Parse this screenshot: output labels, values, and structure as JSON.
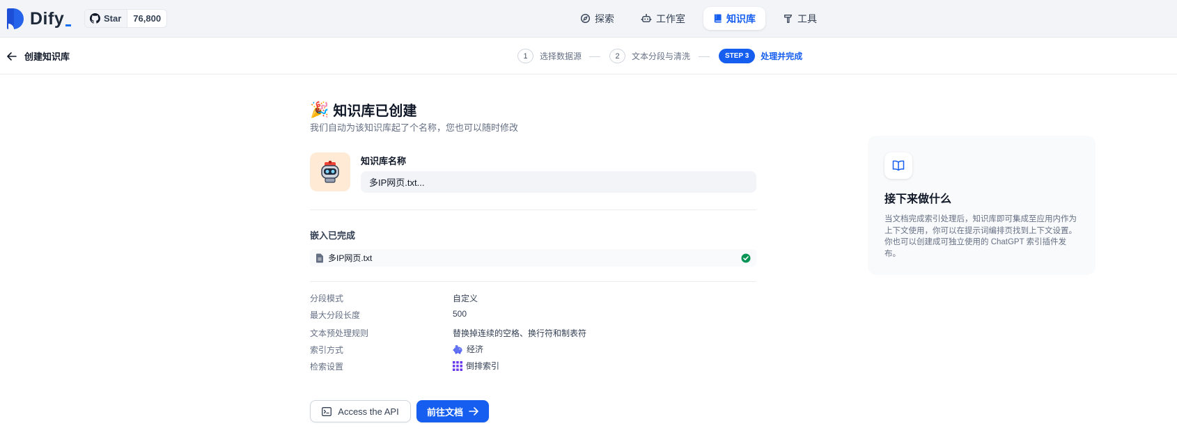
{
  "app": {
    "logo_text": "Dify"
  },
  "github": {
    "star_label": "Star",
    "star_count": "76,800"
  },
  "nav": [
    {
      "label": "探索",
      "icon": "compass-icon"
    },
    {
      "label": "工作室",
      "icon": "robot-icon"
    },
    {
      "label": "知识库",
      "icon": "book-icon",
      "active": true
    },
    {
      "label": "工具",
      "icon": "hammer-icon"
    }
  ],
  "subheader": {
    "back_label": "创建知识库",
    "steps": [
      {
        "num": "1",
        "label": "选择数据源"
      },
      {
        "num": "2",
        "label": "文本分段与清洗"
      },
      {
        "num": "STEP 3",
        "label": "处理并完成",
        "active": true
      }
    ]
  },
  "main": {
    "title": "知识库已创建",
    "description": "我们自动为该知识库起了个名称，您也可以随时修改",
    "kb_name_label": "知识库名称",
    "kb_name_value": "多IP网页.txt...",
    "embed_title": "嵌入已完成",
    "file_name": "多IP网页.txt",
    "info": [
      {
        "label": "分段模式",
        "value": "自定义"
      },
      {
        "label": "最大分段长度",
        "value": "500"
      },
      {
        "label": "文本预处理规则",
        "value": "替换掉连续的空格、换行符和制表符"
      },
      {
        "label": "索引方式",
        "value": "经济",
        "icon": "piggy-bank-icon"
      },
      {
        "label": "检索设置",
        "value": "倒排索引",
        "icon": "grid-dots-icon"
      }
    ],
    "api_button": "Access the API",
    "docs_button": "前往文档"
  },
  "next": {
    "title": "接下来做什么",
    "description": "当文档完成索引处理后，知识库即可集成至应用内作为上下文使用，你可以在提示词编排页找到上下文设置。你也可以创建成可独立使用的 ChatGPT 索引插件发布。"
  },
  "colors": {
    "accent": "#155eef",
    "success": "#079455",
    "icon_bg": "#ffead5"
  }
}
